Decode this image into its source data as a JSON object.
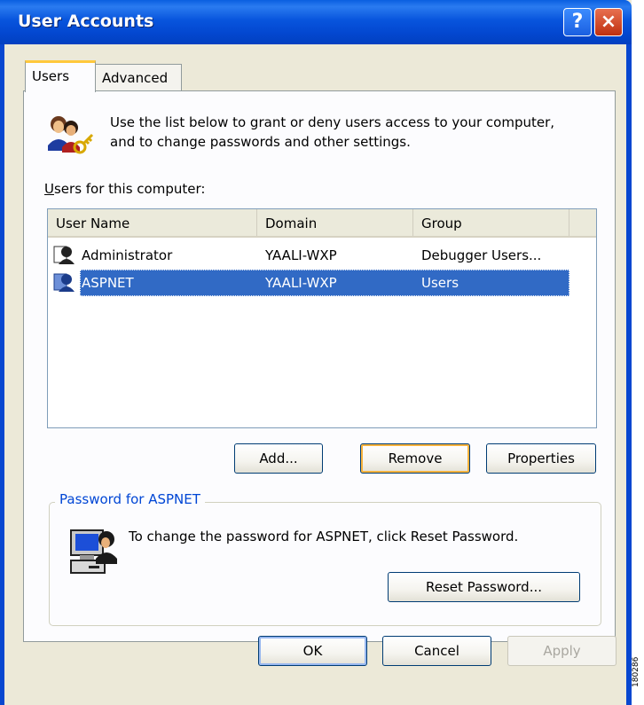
{
  "window": {
    "title": "User Accounts",
    "help_label": "?",
    "close_label": "×"
  },
  "tabs": [
    {
      "label": "Users",
      "active": true
    },
    {
      "label": "Advanced",
      "active": false
    }
  ],
  "intro": {
    "icon": "users-key-icon",
    "text": "Use the list below to grant or deny users access to your computer, and to change passwords and other settings."
  },
  "users_list": {
    "label": "Users for this computer:",
    "columns": [
      "User Name",
      "Domain",
      "Group"
    ],
    "rows": [
      {
        "user": "Administrator",
        "domain": "YAALI-WXP",
        "group": "Debugger Users...",
        "selected": false
      },
      {
        "user": "ASPNET",
        "domain": "YAALI-WXP",
        "group": "Users",
        "selected": true
      }
    ]
  },
  "list_buttons": {
    "add": "Add...",
    "remove": "Remove",
    "properties": "Properties"
  },
  "password_group": {
    "title": "Password for ASPNET",
    "icon": "computer-user-icon",
    "text": "To change the password for ASPNET, click Reset Password.",
    "reset_button": "Reset Password..."
  },
  "dialog_buttons": {
    "ok": "OK",
    "cancel": "Cancel",
    "apply": "Apply"
  },
  "colors": {
    "titlebar": "#0a5fe0",
    "selection": "#316ac5",
    "group_title": "#0046d5",
    "focus_ring": "#f8b33d"
  },
  "margin_tag": "180286"
}
